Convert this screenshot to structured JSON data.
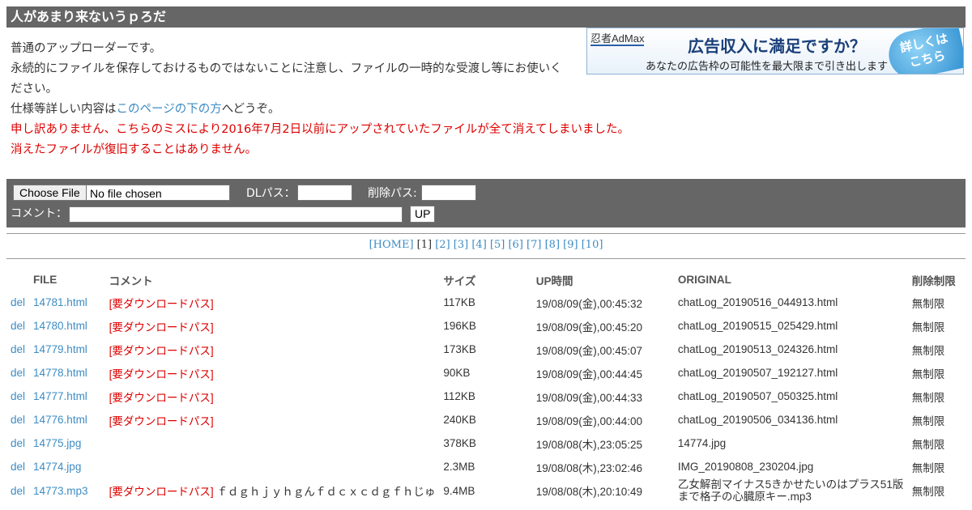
{
  "header": {
    "title": "人があまり来ないうｐろだ"
  },
  "intro": {
    "line1": "普通のアップローダーです。",
    "line2": "永続的にファイルを保存しておけるものではないことに注意し、ファイルの一時的な受渡し等にお使いく",
    "line3": "ださい。",
    "line4_prefix": "仕様等詳しい内容は",
    "line4_link": "このページの下の方",
    "line4_suffix": "へどうぞ。",
    "notice1": "申し訳ありません、こちらのミスにより2016年7月2日以前にアップされていたファイルが全て消えてしまいました。",
    "notice2": "消えたファイルが復旧することはありません。"
  },
  "ad": {
    "logo": "忍者AdMax",
    "headline": "広告収入に満足ですか？",
    "subline": "あなたの広告枠の可能性を最大限まで引き出します",
    "cta_line1": "詳しくは",
    "cta_line2": "こちら"
  },
  "form": {
    "file_button": "Choose File",
    "file_status": "No file chosen",
    "dl_pass_label": "DLパス：",
    "dl_pass_value": "",
    "delete_pass_label": "削除パス:",
    "delete_pass_value": "",
    "comment_label": "コメント：",
    "comment_value": "",
    "upload_button": "UP"
  },
  "pager": {
    "home": "[HOME]",
    "current": "[1]",
    "pages": [
      "[2]",
      "[3]",
      "[4]",
      "[5]",
      "[6]",
      "[7]",
      "[8]",
      "[9]",
      "[10]"
    ]
  },
  "table": {
    "headers": [
      "",
      "FILE",
      "コメント",
      "サイズ",
      "UP時間",
      "ORIGINAL",
      "削除制限"
    ],
    "rows": [
      {
        "del": "del",
        "file": "14781.html",
        "comment_tag": "[要ダウンロードパス]",
        "comment": "",
        "size": "117KB",
        "time": "19/08/09(金),00:45:32",
        "original": "chatLog_20190516_044913.html",
        "limit": "無制限"
      },
      {
        "del": "del",
        "file": "14780.html",
        "comment_tag": "[要ダウンロードパス]",
        "comment": "",
        "size": "196KB",
        "time": "19/08/09(金),00:45:20",
        "original": "chatLog_20190515_025429.html",
        "limit": "無制限"
      },
      {
        "del": "del",
        "file": "14779.html",
        "comment_tag": "[要ダウンロードパス]",
        "comment": "",
        "size": "173KB",
        "time": "19/08/09(金),00:45:07",
        "original": "chatLog_20190513_024326.html",
        "limit": "無制限"
      },
      {
        "del": "del",
        "file": "14778.html",
        "comment_tag": "[要ダウンロードパス]",
        "comment": "",
        "size": "90KB",
        "time": "19/08/09(金),00:44:45",
        "original": "chatLog_20190507_192127.html",
        "limit": "無制限"
      },
      {
        "del": "del",
        "file": "14777.html",
        "comment_tag": "[要ダウンロードパス]",
        "comment": "",
        "size": "112KB",
        "time": "19/08/09(金),00:44:33",
        "original": "chatLog_20190507_050325.html",
        "limit": "無制限"
      },
      {
        "del": "del",
        "file": "14776.html",
        "comment_tag": "[要ダウンロードパス]",
        "comment": "",
        "size": "240KB",
        "time": "19/08/09(金),00:44:00",
        "original": "chatLog_20190506_034136.html",
        "limit": "無制限"
      },
      {
        "del": "del",
        "file": "14775.jpg",
        "comment_tag": "",
        "comment": "",
        "size": "378KB",
        "time": "19/08/08(木),23:05:25",
        "original": "14774.jpg",
        "limit": "無制限"
      },
      {
        "del": "del",
        "file": "14774.jpg",
        "comment_tag": "",
        "comment": "",
        "size": "2.3MB",
        "time": "19/08/08(木),23:02:46",
        "original": "IMG_20190808_230204.jpg",
        "limit": "無制限"
      },
      {
        "del": "del",
        "file": "14773.mp3",
        "comment_tag": "[要ダウンロードパス]",
        "comment": " ｆｄｇｈｊｙｈｇんｆｄｃｘｃｄｇｆｈじゅ",
        "size": "9.4MB",
        "time": "19/08/08(木),20:10:49",
        "original": "乙女解剖マイナス5きかせたいのはプラス51版まで格子の心臓原キー.mp3",
        "limit": "無制限"
      }
    ]
  }
}
